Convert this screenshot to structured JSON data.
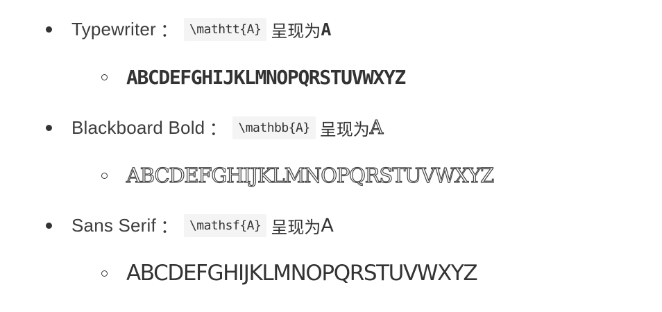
{
  "items": [
    {
      "label": "Typewriter",
      "colon": "：",
      "code": "\\mathtt{A}",
      "desc": "呈现为",
      "sample": "A",
      "alphabet": "ABCDEFGHIJKLMNOPQRSTUVWXYZ"
    },
    {
      "label": "Blackboard Bold",
      "colon": "：",
      "code": "\\mathbb{A}",
      "desc": "呈现为",
      "sample": "A",
      "alphabet": "ABCDEFGHIJKLMNOPQRSTUVWXYZ"
    },
    {
      "label": "Sans Serif",
      "colon": "：",
      "code": "\\mathsf{A}",
      "desc": "呈现为",
      "sample": "A",
      "alphabet": "ABCDEFGHIJKLMNOPQRSTUVWXYZ"
    }
  ]
}
